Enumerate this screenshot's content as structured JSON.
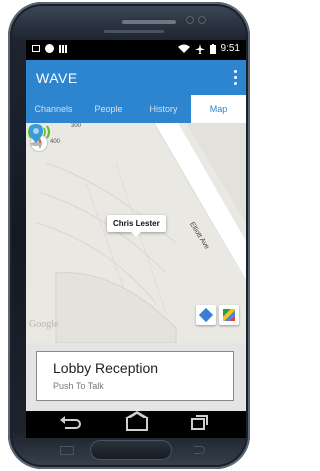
{
  "status_bar": {
    "time": "9:51"
  },
  "app_bar": {
    "title": "WAVE",
    "overflow_icon": "more-vert-icon"
  },
  "tabs": [
    {
      "label": "Channels",
      "active": false
    },
    {
      "label": "People",
      "active": false
    },
    {
      "label": "History",
      "active": false
    },
    {
      "label": "Map",
      "active": true
    }
  ],
  "map": {
    "callout_name": "Chris Lester",
    "street_label": "Elliott Ave",
    "label_400": "400",
    "label_300": "300",
    "watermark": "Google"
  },
  "ptt_card": {
    "title": "Lobby Reception",
    "subtitle": "Push To Talk"
  },
  "colors": {
    "brand_blue": "#2d84cf",
    "signal_green": "#5cbf2a",
    "pin_blue": "#3d9ad9"
  }
}
